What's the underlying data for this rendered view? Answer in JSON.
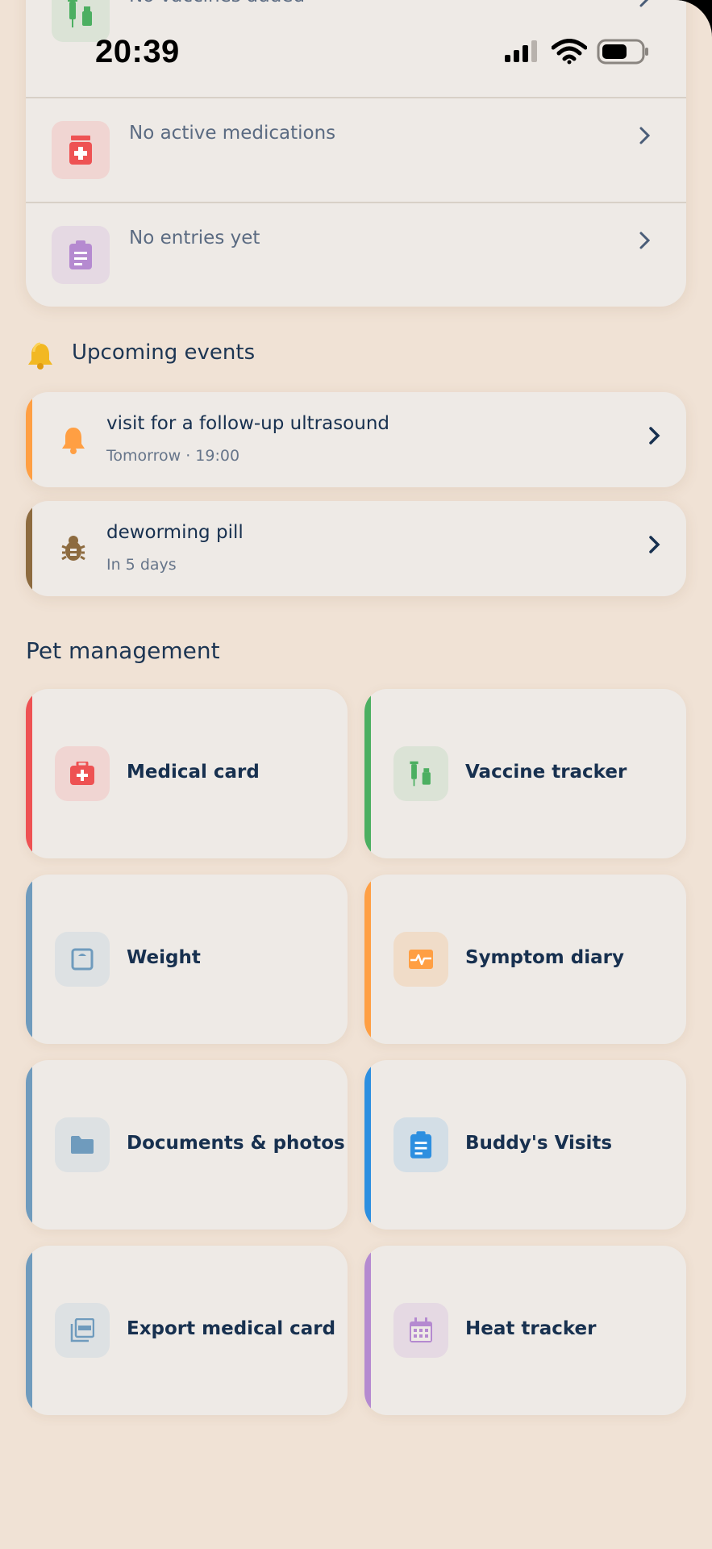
{
  "status_bar": {
    "time": "20:39"
  },
  "records": [
    {
      "text": "No vaccines added",
      "icon": "syringe-vial-icon"
    },
    {
      "text": "No active medications",
      "icon": "medication-bottle-icon"
    },
    {
      "text": "No entries yet",
      "icon": "clipboard-icon"
    }
  ],
  "upcoming": {
    "title": "Upcoming events",
    "events": [
      {
        "title": "visit for a follow-up ultrasound",
        "sub": "Tomorrow · 19:00",
        "accent": "#ff9f43",
        "icon": "bell-icon"
      },
      {
        "title": "deworming pill",
        "sub": "In 5 days",
        "accent": "#8d6b3f",
        "icon": "bug-icon"
      }
    ]
  },
  "management": {
    "title": "Pet management",
    "tiles": [
      {
        "label": "Medical card",
        "accent": "#ee5253",
        "icon": "medical-kit-icon"
      },
      {
        "label": "Vaccine tracker",
        "accent": "#4caf61",
        "icon": "syringe-vial-icon"
      },
      {
        "label": "Weight",
        "accent": "#6f9bbd",
        "icon": "scale-icon"
      },
      {
        "label": "Symptom diary",
        "accent": "#ff9f43",
        "icon": "heartbeat-icon"
      },
      {
        "label": "Documents & photos",
        "accent": "#6f9bbd",
        "icon": "folder-icon"
      },
      {
        "label": "Buddy's Visits",
        "accent": "#2d8fe0",
        "icon": "clipboard-icon"
      },
      {
        "label": "Export medical card",
        "accent": "#6f9bbd",
        "icon": "pdf-icon"
      },
      {
        "label": "Heat tracker",
        "accent": "#b58ad0",
        "icon": "calendar-icon"
      }
    ]
  }
}
